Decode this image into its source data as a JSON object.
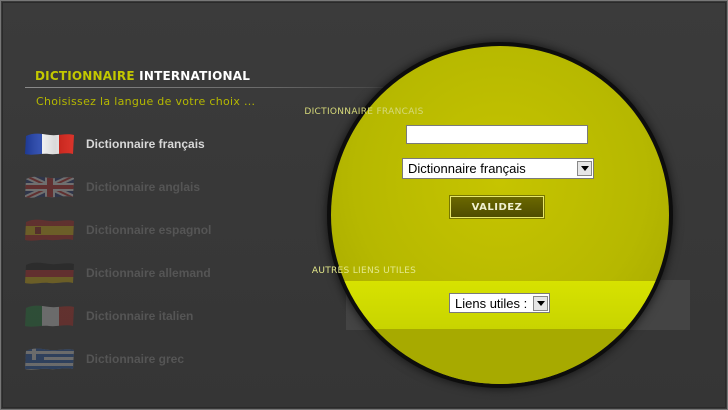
{
  "header": {
    "title_part1": "DICTIONNAIRE",
    "title_part2": "INTERNATIONAL",
    "subtitle": "Choisissez la langue de votre choix ..."
  },
  "languages": [
    {
      "label": "Dictionnaire français",
      "flag": "france-flag-icon",
      "active": true
    },
    {
      "label": "Dictionnaire anglais",
      "flag": "uk-flag-icon",
      "active": false
    },
    {
      "label": "Dictionnaire espagnol",
      "flag": "spain-flag-icon",
      "active": false
    },
    {
      "label": "Dictionnaire allemand",
      "flag": "germany-flag-icon",
      "active": false
    },
    {
      "label": "Dictionnaire italien",
      "flag": "italy-flag-icon",
      "active": false
    },
    {
      "label": "Dictionnaire grec",
      "flag": "greece-flag-icon",
      "active": false
    }
  ],
  "search": {
    "section_label": "DICTIONNAIRE FRANCAIS",
    "input_value": "",
    "dictionary_select_value": "Dictionnaire français",
    "submit_label": "VALIDEZ"
  },
  "links": {
    "section_label": "AUTRES LIENS UTILES",
    "select_value": "Liens utiles :"
  },
  "colors": {
    "accent": "#c3c800",
    "circle": "#b8ba00",
    "background": "#383838"
  }
}
